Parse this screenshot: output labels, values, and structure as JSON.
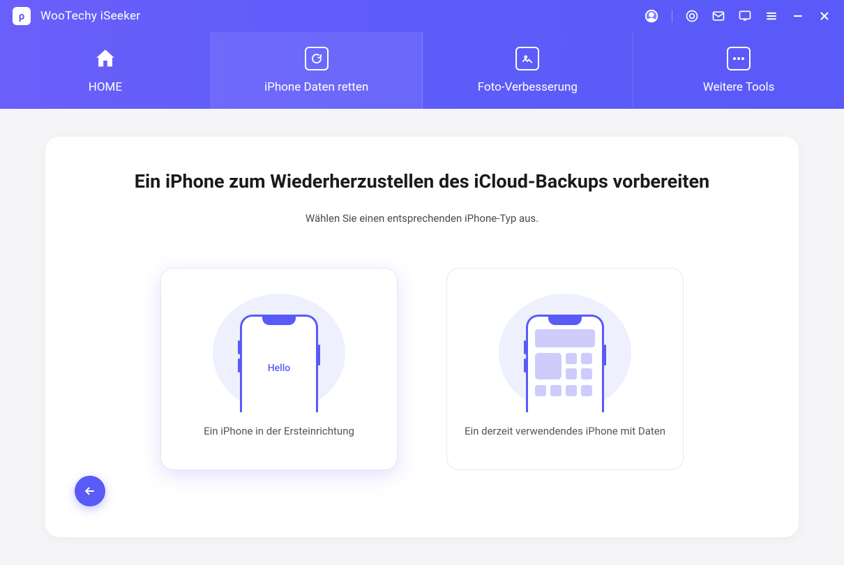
{
  "app": {
    "title": "WooTechy iSeeker",
    "logo_letter": "ρ"
  },
  "nav": {
    "items": [
      {
        "label": "HOME"
      },
      {
        "label": "iPhone Daten retten"
      },
      {
        "label": "Foto-Verbesserung"
      },
      {
        "label": "Weitere Tools"
      }
    ],
    "active_index": 1
  },
  "main": {
    "title": "Ein iPhone zum Wiederherzustellen des iCloud-Backups vorbereiten",
    "subtitle": "Wählen Sie einen entsprechenden iPhone-Typ aus.",
    "options": [
      {
        "label": "Ein iPhone in der Ersteinrichtung",
        "phone_text": "Hello",
        "selected": true
      },
      {
        "label": "Ein derzeit verwendendes iPhone mit Daten",
        "selected": false
      }
    ]
  }
}
